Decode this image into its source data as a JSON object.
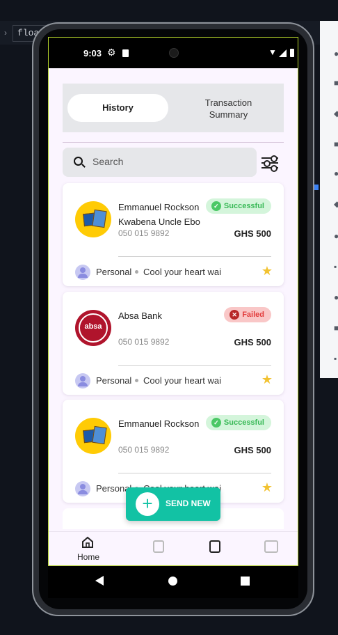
{
  "ide": {
    "tab_label": "float"
  },
  "status_bar": {
    "time": "9:03"
  },
  "tabs": {
    "history": "History",
    "summary_line1": "Transaction",
    "summary_line2": "Summary"
  },
  "search": {
    "placeholder": "Search"
  },
  "transactions": [
    {
      "name": "Emmanuel Rockson",
      "subname": "Kwabena Uncle Ebo",
      "phone": "050 015 9892",
      "amount": "GHS 500",
      "status": "Successful",
      "category": "Personal",
      "note": "Cool your heart wai",
      "provider": "MTN"
    },
    {
      "name": "Absa Bank",
      "subname": "",
      "phone": "050 015 9892",
      "amount": "GHS 500",
      "status": "Failed",
      "category": "Personal",
      "note": "Cool your heart wai",
      "provider": "absa"
    },
    {
      "name": "Emmanuel Rockson",
      "subname": "",
      "phone": "050 015 9892",
      "amount": "GHS 500",
      "status": "Successful",
      "category": "Personal",
      "note": "Cool your heart wai",
      "provider": "MTN"
    }
  ],
  "fab": {
    "label": "SEND NEW"
  },
  "nav": {
    "home": "Home"
  },
  "colors": {
    "accent": "#12c2a4",
    "success": "#39b957",
    "failed": "#e23b3b",
    "star": "#f2c230"
  }
}
